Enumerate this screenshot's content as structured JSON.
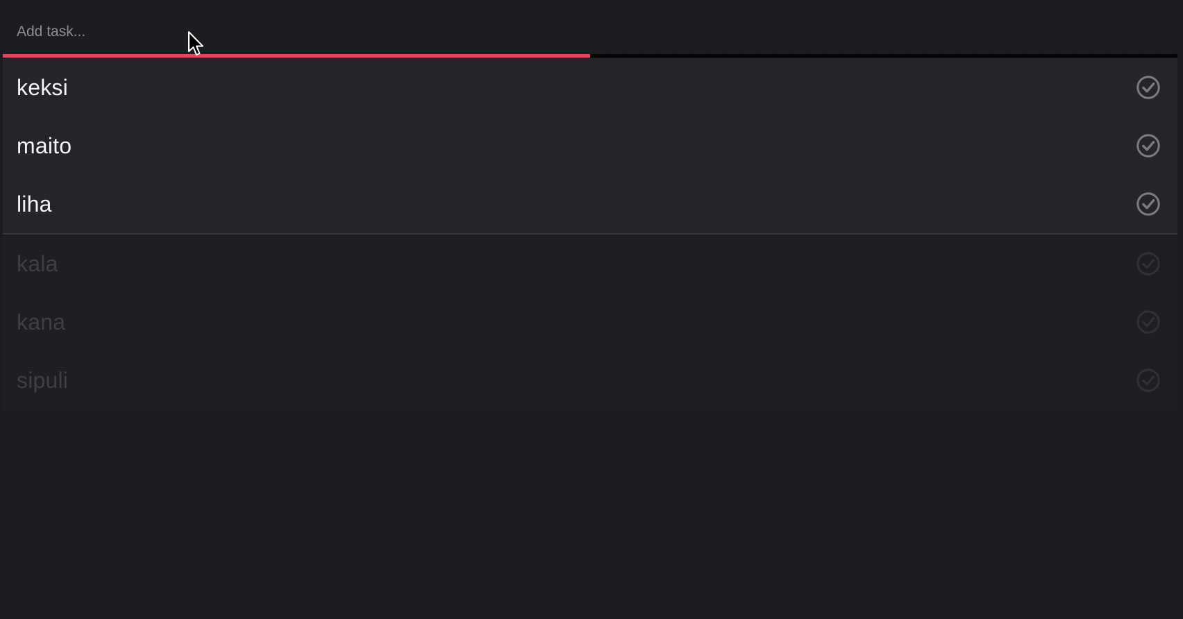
{
  "input": {
    "placeholder": "Add task...",
    "value": ""
  },
  "progress": {
    "fraction": 0.5,
    "color": "#e8435f"
  },
  "active_tasks": [
    {
      "label": "keksi",
      "done": false
    },
    {
      "label": "maito",
      "done": false
    },
    {
      "label": "liha",
      "done": false
    }
  ],
  "completed_tasks": [
    {
      "label": "kala",
      "done": true
    },
    {
      "label": "kana",
      "done": true
    },
    {
      "label": "sipuli",
      "done": true
    }
  ],
  "icons": {
    "check": "check-circle-icon",
    "cursor": "mouse-pointer-icon"
  },
  "colors": {
    "background": "#1b1b1f",
    "active_text": "#f4f4f6",
    "done_text": "#3e3e44",
    "active_icon": "#7a7a80",
    "done_icon": "#303035"
  }
}
